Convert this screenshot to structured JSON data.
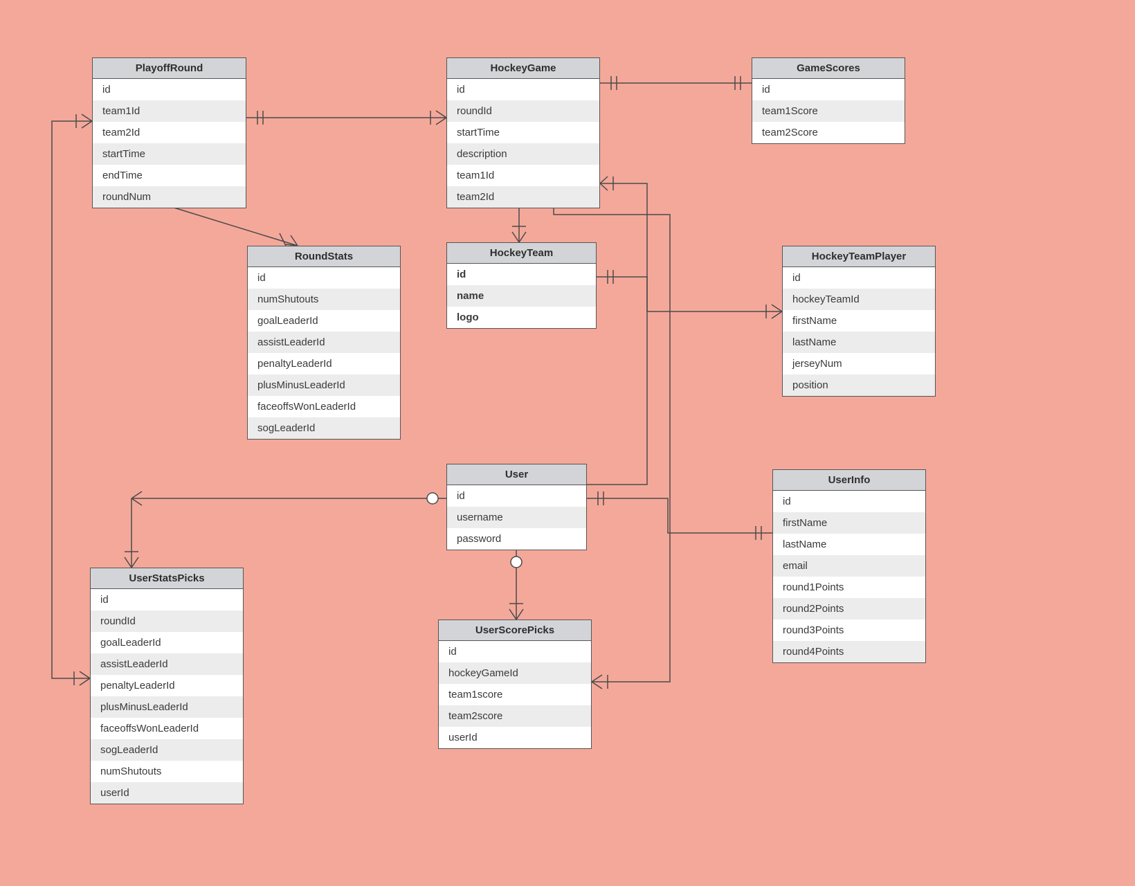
{
  "entities": {
    "playoffRound": {
      "title": "PlayoffRound",
      "fields": [
        "id",
        "team1Id",
        "team2Id",
        "startTime",
        "endTime",
        "roundNum"
      ]
    },
    "hockeyGame": {
      "title": "HockeyGame",
      "fields": [
        "id",
        "roundId",
        "startTime",
        "description",
        "team1Id",
        "team2Id"
      ]
    },
    "gameScores": {
      "title": "GameScores",
      "fields": [
        "id",
        "team1Score",
        "team2Score"
      ]
    },
    "roundStats": {
      "title": "RoundStats",
      "fields": [
        "id",
        "numShutouts",
        "goalLeaderId",
        "assistLeaderId",
        "penaltyLeaderId",
        "plusMinusLeaderId",
        "faceoffsWonLeaderId",
        "sogLeaderId"
      ]
    },
    "hockeyTeam": {
      "title": "HockeyTeam",
      "fields": [
        "id",
        "name",
        "logo"
      ],
      "bold": true
    },
    "hockeyTeamPlayer": {
      "title": "HockeyTeamPlayer",
      "fields": [
        "id",
        "hockeyTeamId",
        "firstName",
        "lastName",
        "jerseyNum",
        "position"
      ]
    },
    "user": {
      "title": "User",
      "fields": [
        "id",
        "username",
        "password"
      ]
    },
    "userInfo": {
      "title": "UserInfo",
      "fields": [
        "id",
        "firstName",
        "lastName",
        "email",
        "round1Points",
        "round2Points",
        "round3Points",
        "round4Points"
      ]
    },
    "userStatsPicks": {
      "title": "UserStatsPicks",
      "fields": [
        "id",
        "roundId",
        "goalLeaderId",
        "assistLeaderId",
        "penaltyLeaderId",
        "plusMinusLeaderId",
        "faceoffsWonLeaderId",
        "sogLeaderId",
        "numShutouts",
        "userId"
      ]
    },
    "userScorePicks": {
      "title": "UserScorePicks",
      "fields": [
        "id",
        "hockeyGameId",
        "team1score",
        "team2score",
        "userId"
      ]
    }
  },
  "relations": [
    {
      "from": "PlayoffRound",
      "to": "HockeyGame",
      "type": "one-to-many"
    },
    {
      "from": "HockeyGame",
      "to": "GameScores",
      "type": "one-to-one"
    },
    {
      "from": "PlayoffRound",
      "to": "RoundStats",
      "type": "one-to-many"
    },
    {
      "from": "HockeyTeam",
      "to": "HockeyGame",
      "type": "one-to-many"
    },
    {
      "from": "HockeyTeam",
      "to": "HockeyTeamPlayer",
      "type": "one-to-many"
    },
    {
      "from": "User",
      "to": "UserStatsPicks",
      "type": "zero-or-one-to-many"
    },
    {
      "from": "User",
      "to": "UserScorePicks",
      "type": "zero-or-one-to-many"
    },
    {
      "from": "User",
      "to": "UserInfo",
      "type": "one-to-one"
    },
    {
      "from": "User",
      "to": "HockeyGame",
      "type": "many-to-many"
    },
    {
      "from": "PlayoffRound",
      "to": "UserStatsPicks",
      "type": "one-to-many"
    },
    {
      "from": "HockeyGame",
      "to": "UserScorePicks",
      "type": "one-to-many"
    }
  ]
}
